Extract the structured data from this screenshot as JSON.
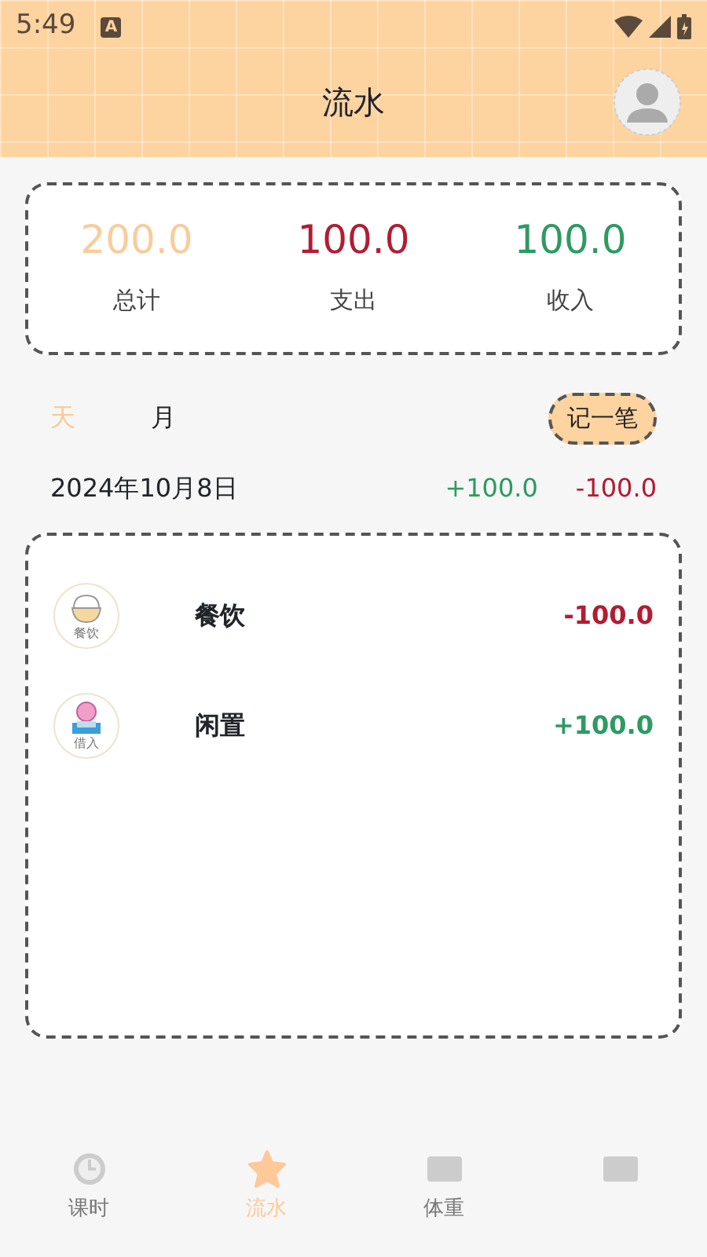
{
  "status_bar": {
    "time": "5:49",
    "notification_icon": "A"
  },
  "header": {
    "title": "流水"
  },
  "summary": [
    {
      "kind": "total",
      "value": "200.0",
      "label": "总计"
    },
    {
      "kind": "expense",
      "value": "100.0",
      "label": "支出"
    },
    {
      "kind": "income",
      "value": "100.0",
      "label": "收入"
    }
  ],
  "period_tabs": [
    {
      "label": "天",
      "selected": true
    },
    {
      "label": "月",
      "selected": false
    }
  ],
  "add_button": "记一笔",
  "day": {
    "date": "2024年10月8日",
    "income": "+100.0",
    "expense": "-100.0"
  },
  "entries": [
    {
      "kind": "expense",
      "icon_label": "餐饮",
      "name": "餐饮",
      "amount": "-100.0"
    },
    {
      "kind": "income",
      "icon_label": "借入",
      "name": "闲置",
      "amount": "+100.0"
    }
  ],
  "bottom_nav": [
    {
      "label": "课时",
      "selected": false
    },
    {
      "label": "流水",
      "selected": true
    },
    {
      "label": "体重",
      "selected": false
    },
    {
      "selected": false
    }
  ]
}
